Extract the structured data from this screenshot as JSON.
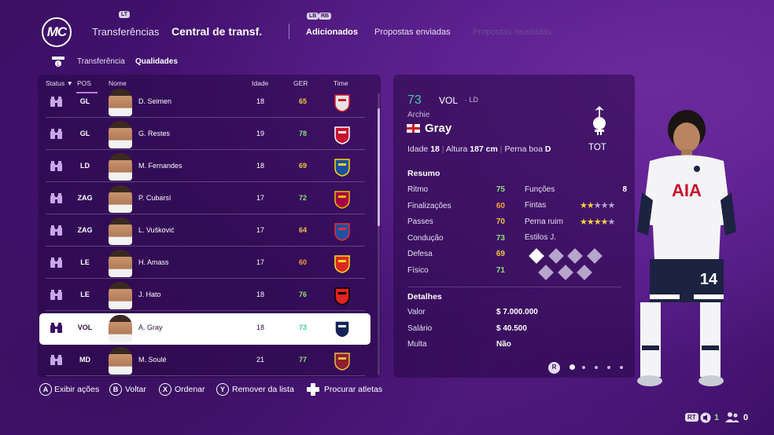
{
  "header": {
    "logo": "MC",
    "tabs": [
      {
        "label": "Transferências"
      },
      {
        "label": "Central de transf."
      },
      {
        "label": "Adicionados"
      },
      {
        "label": "Propostas enviadas"
      },
      {
        "label": "Propostas recebidas"
      }
    ],
    "hints": {
      "top": "LT",
      "lb": "LB",
      "rb": "RB"
    }
  },
  "subbar": {
    "tabs": [
      {
        "label": "Transferência"
      },
      {
        "label": "Qualidades"
      }
    ]
  },
  "table": {
    "headers": {
      "status": "Status",
      "pos": "POS",
      "name": "Nome",
      "age": "Idade",
      "ger": "GER",
      "club": "Time"
    },
    "rows": [
      {
        "pos": "GL",
        "name": "D. Seimen",
        "age": "18",
        "ger": "65",
        "ger_color": "#f5c542",
        "club_color": "#e5e5e5",
        "club_accent": "#d81e2c"
      },
      {
        "pos": "GL",
        "name": "G. Restes",
        "age": "19",
        "ger": "78",
        "ger_color": "#8fe07a",
        "club_color": "#c8102e",
        "club_accent": "#ffffff"
      },
      {
        "pos": "LD",
        "name": "M. Fernandes",
        "age": "18",
        "ger": "69",
        "ger_color": "#f5c542",
        "club_color": "#1c4fa0",
        "club_accent": "#ffd700"
      },
      {
        "pos": "ZAG",
        "name": "P. Cubarsí",
        "age": "17",
        "ger": "72",
        "ger_color": "#8fe07a",
        "club_color": "#a50044",
        "club_accent": "#edbb00"
      },
      {
        "pos": "ZAG",
        "name": "L. Vušković",
        "age": "17",
        "ger": "64",
        "ger_color": "#f5c542",
        "club_color": "#1e4fa3",
        "club_accent": "#e03030"
      },
      {
        "pos": "LE",
        "name": "H. Amass",
        "age": "17",
        "ger": "60",
        "ger_color": "#f5a23a",
        "club_color": "#da291c",
        "club_accent": "#fbe122"
      },
      {
        "pos": "LE",
        "name": "J. Hato",
        "age": "18",
        "ger": "76",
        "ger_color": "#8fe07a",
        "club_color": "#e32221",
        "club_accent": "#000000"
      },
      {
        "pos": "VOL",
        "name": "A. Gray",
        "age": "18",
        "ger": "73",
        "ger_color": "#3fc9a8",
        "club_color": "#132257",
        "club_accent": "#ffffff",
        "selected": true
      },
      {
        "pos": "MD",
        "name": "M. Soulé",
        "age": "21",
        "ger": "77",
        "ger_color": "#8fe07a",
        "club_color": "#8e1f2f",
        "club_accent": "#f0bc42"
      }
    ]
  },
  "player": {
    "ovr": "73",
    "pos": "VOL",
    "alt_pos": "LD",
    "first_name": "Archie",
    "last_name": "Gray",
    "age_label": "Idade",
    "age": "18",
    "height_label": "Altura",
    "height": "187 cm",
    "foot_label": "Perna boa",
    "foot": "D",
    "club": "TOT",
    "summary_title": "Resumo",
    "stats": [
      {
        "label": "Ritmo",
        "value": "75",
        "color": "#8fe07a"
      },
      {
        "label": "Finalizações",
        "value": "60",
        "color": "#f5a23a"
      },
      {
        "label": "Passes",
        "value": "70",
        "color": "#f5c542"
      },
      {
        "label": "Condução",
        "value": "73",
        "color": "#8fe07a"
      },
      {
        "label": "Defesa",
        "value": "69",
        "color": "#f5c542"
      },
      {
        "label": "Físico",
        "value": "71",
        "color": "#8fe07a"
      }
    ],
    "extras": {
      "functions_label": "Funções",
      "functions": "8",
      "skill_label": "Fintas",
      "skill_stars": 2,
      "weak_label": "Perna ruim",
      "weak_stars": 4,
      "styles_label": "Estilos J."
    },
    "details_title": "Detalhes",
    "details": [
      {
        "label": "Valor",
        "value": "$ 7.000.000"
      },
      {
        "label": "Salário",
        "value": "$ 40.500"
      },
      {
        "label": "Multa",
        "value": "Não"
      }
    ],
    "pager_hint": "R",
    "shirt_sponsor": "AIA",
    "shirt_number": "14"
  },
  "footer": {
    "actions": [
      {
        "key": "A",
        "label": "Exibir ações"
      },
      {
        "key": "B",
        "label": "Voltar"
      },
      {
        "key": "X",
        "label": "Ordenar"
      },
      {
        "key": "Y",
        "label": "Remover da lista"
      },
      {
        "key": "",
        "label": "Procurar atletas"
      }
    ],
    "rt": "RT",
    "count1": "1",
    "count2": "0"
  },
  "colors": {
    "accent": "#3fc9a8",
    "star": "#f5d33a",
    "star_off": "#b7a5cc",
    "panel": "#2a0948"
  }
}
